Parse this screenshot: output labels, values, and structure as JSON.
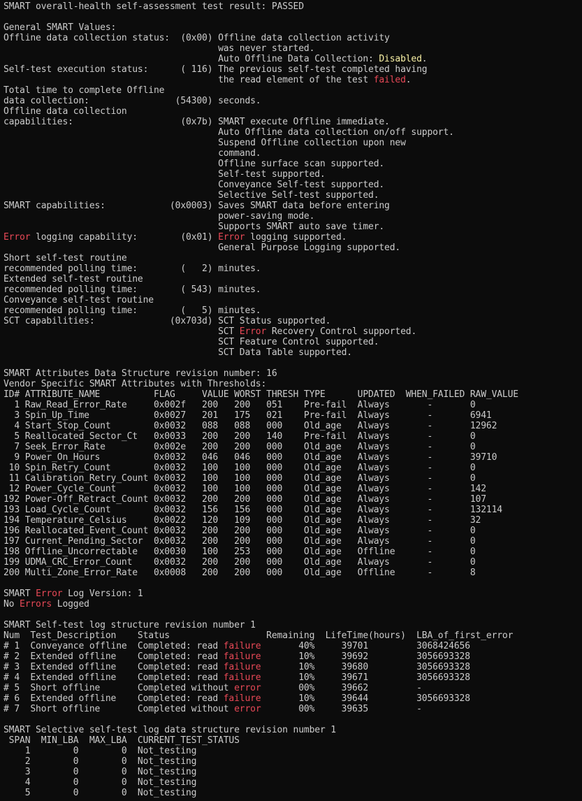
{
  "colors": {
    "background": "#0c0c0c",
    "text": "#cccccc",
    "red": "#e74856",
    "yellow": "#f9f1a5"
  },
  "lines": [
    [
      [
        "SMART overall-health self-assessment test result: PASSED",
        ""
      ]
    ],
    [
      [
        "",
        ""
      ]
    ],
    [
      [
        "General SMART Values:",
        ""
      ]
    ],
    [
      [
        "Offline data collection status:  (0x00) Offline data collection activity",
        ""
      ]
    ],
    [
      [
        "                                        was never started.",
        ""
      ]
    ],
    [
      [
        "                                        Auto Offline Data Collection: ",
        ""
      ],
      [
        "Disabled",
        "yellow"
      ],
      [
        ".",
        ""
      ]
    ],
    [
      [
        "Self-test execution status:      ( 116) The previous self-test completed having",
        ""
      ]
    ],
    [
      [
        "                                        the read element of the test ",
        ""
      ],
      [
        "failed",
        "red"
      ],
      [
        ".",
        ""
      ]
    ],
    [
      [
        "Total time to complete Offline",
        ""
      ]
    ],
    [
      [
        "data collection:                (54300) seconds.",
        ""
      ]
    ],
    [
      [
        "Offline data collection",
        ""
      ]
    ],
    [
      [
        "capabilities:                    (0x7b) SMART execute Offline immediate.",
        ""
      ]
    ],
    [
      [
        "                                        Auto Offline data collection on/off support.",
        ""
      ]
    ],
    [
      [
        "                                        Suspend Offline collection upon new",
        ""
      ]
    ],
    [
      [
        "                                        command.",
        ""
      ]
    ],
    [
      [
        "                                        Offline surface scan supported.",
        ""
      ]
    ],
    [
      [
        "                                        Self-test supported.",
        ""
      ]
    ],
    [
      [
        "                                        Conveyance Self-test supported.",
        ""
      ]
    ],
    [
      [
        "                                        Selective Self-test supported.",
        ""
      ]
    ],
    [
      [
        "SMART capabilities:            (0x0003) Saves SMART data before entering",
        ""
      ]
    ],
    [
      [
        "                                        power-saving mode.",
        ""
      ]
    ],
    [
      [
        "                                        Supports SMART auto save timer.",
        ""
      ]
    ],
    [
      [
        "Error",
        "red"
      ],
      [
        " logging capability:        (0x01) ",
        ""
      ],
      [
        "Error",
        "red"
      ],
      [
        " logging supported.",
        ""
      ]
    ],
    [
      [
        "                                        General Purpose Logging supported.",
        ""
      ]
    ],
    [
      [
        "Short self-test routine",
        ""
      ]
    ],
    [
      [
        "recommended polling time:        (   2) minutes.",
        ""
      ]
    ],
    [
      [
        "Extended self-test routine",
        ""
      ]
    ],
    [
      [
        "recommended polling time:        ( 543) minutes.",
        ""
      ]
    ],
    [
      [
        "Conveyance self-test routine",
        ""
      ]
    ],
    [
      [
        "recommended polling time:        (   5) minutes.",
        ""
      ]
    ],
    [
      [
        "SCT capabilities:              (0x703d) SCT Status supported.",
        ""
      ]
    ],
    [
      [
        "                                        SCT ",
        ""
      ],
      [
        "Error",
        "red"
      ],
      [
        " Recovery Control supported.",
        ""
      ]
    ],
    [
      [
        "                                        SCT Feature Control supported.",
        ""
      ]
    ],
    [
      [
        "                                        SCT Data Table supported.",
        ""
      ]
    ],
    [
      [
        "",
        ""
      ]
    ],
    [
      [
        "SMART Attributes Data Structure revision number: 16",
        ""
      ]
    ],
    [
      [
        "Vendor Specific SMART Attributes with Thresholds:",
        ""
      ]
    ],
    [
      [
        "ID# ATTRIBUTE_NAME          FLAG     VALUE WORST THRESH TYPE      UPDATED  WHEN_FAILED RAW_VALUE",
        ""
      ]
    ],
    [
      [
        "  1 Raw_Read_Error_Rate     0x002f   200   200   051    Pre-fail  Always       -       0",
        ""
      ]
    ],
    [
      [
        "  3 Spin_Up_Time            0x0027   201   175   021    Pre-fail  Always       -       6941",
        ""
      ]
    ],
    [
      [
        "  4 Start_Stop_Count        0x0032   088   088   000    Old_age   Always       -       12962",
        ""
      ]
    ],
    [
      [
        "  5 Reallocated_Sector_Ct   0x0033   200   200   140    Pre-fail  Always       -       0",
        ""
      ]
    ],
    [
      [
        "  7 Seek_Error_Rate         0x002e   200   200   000    Old_age   Always       -       0",
        ""
      ]
    ],
    [
      [
        "  9 Power_On_Hours          0x0032   046   046   000    Old_age   Always       -       39710",
        ""
      ]
    ],
    [
      [
        " 10 Spin_Retry_Count        0x0032   100   100   000    Old_age   Always       -       0",
        ""
      ]
    ],
    [
      [
        " 11 Calibration_Retry_Count 0x0032   100   100   000    Old_age   Always       -       0",
        ""
      ]
    ],
    [
      [
        " 12 Power_Cycle_Count       0x0032   100   100   000    Old_age   Always       -       142",
        ""
      ]
    ],
    [
      [
        "192 Power-Off_Retract_Count 0x0032   200   200   000    Old_age   Always       -       107",
        ""
      ]
    ],
    [
      [
        "193 Load_Cycle_Count        0x0032   156   156   000    Old_age   Always       -       132114",
        ""
      ]
    ],
    [
      [
        "194 Temperature_Celsius     0x0022   120   109   000    Old_age   Always       -       32",
        ""
      ]
    ],
    [
      [
        "196 Reallocated_Event_Count 0x0032   200   200   000    Old_age   Always       -       0",
        ""
      ]
    ],
    [
      [
        "197 Current_Pending_Sector  0x0032   200   200   000    Old_age   Always       -       0",
        ""
      ]
    ],
    [
      [
        "198 Offline_Uncorrectable   0x0030   100   253   000    Old_age   Offline      -       0",
        ""
      ]
    ],
    [
      [
        "199 UDMA_CRC_Error_Count    0x0032   200   200   000    Old_age   Always       -       0",
        ""
      ]
    ],
    [
      [
        "200 Multi_Zone_Error_Rate   0x0008   200   200   000    Old_age   Offline      -       8",
        ""
      ]
    ],
    [
      [
        "",
        ""
      ]
    ],
    [
      [
        "SMART ",
        ""
      ],
      [
        "Error",
        "red"
      ],
      [
        " Log Version: 1",
        ""
      ]
    ],
    [
      [
        "No ",
        ""
      ],
      [
        "Errors",
        "red"
      ],
      [
        " Logged",
        ""
      ]
    ],
    [
      [
        "",
        ""
      ]
    ],
    [
      [
        "SMART Self-test log structure revision number 1",
        ""
      ]
    ],
    [
      [
        "Num  Test_Description    Status                  Remaining  LifeTime(hours)  LBA_of_first_error",
        ""
      ]
    ],
    [
      [
        "# 1  Conveyance offline  Completed: read ",
        ""
      ],
      [
        "failure",
        "red"
      ],
      [
        "       40%     39701         3068424656",
        ""
      ]
    ],
    [
      [
        "# 2  Extended offline    Completed: read ",
        ""
      ],
      [
        "failure",
        "red"
      ],
      [
        "       10%     39692         3056693328",
        ""
      ]
    ],
    [
      [
        "# 3  Extended offline    Completed: read ",
        ""
      ],
      [
        "failure",
        "red"
      ],
      [
        "       10%     39680         3056693328",
        ""
      ]
    ],
    [
      [
        "# 4  Extended offline    Completed: read ",
        ""
      ],
      [
        "failure",
        "red"
      ],
      [
        "       10%     39671         3056693328",
        ""
      ]
    ],
    [
      [
        "# 5  Short offline       Completed without ",
        ""
      ],
      [
        "error",
        "red"
      ],
      [
        "       00%     39662         -",
        ""
      ]
    ],
    [
      [
        "# 6  Extended offline    Completed: read ",
        ""
      ],
      [
        "failure",
        "red"
      ],
      [
        "       10%     39644         3056693328",
        ""
      ]
    ],
    [
      [
        "# 7  Short offline       Completed without ",
        ""
      ],
      [
        "error",
        "red"
      ],
      [
        "       00%     39635         -",
        ""
      ]
    ],
    [
      [
        "",
        ""
      ]
    ],
    [
      [
        "SMART Selective self-test log data structure revision number 1",
        ""
      ]
    ],
    [
      [
        " SPAN  MIN_LBA  MAX_LBA  CURRENT_TEST_STATUS",
        ""
      ]
    ],
    [
      [
        "    1        0        0  Not_testing",
        ""
      ]
    ],
    [
      [
        "    2        0        0  Not_testing",
        ""
      ]
    ],
    [
      [
        "    3        0        0  Not_testing",
        ""
      ]
    ],
    [
      [
        "    4        0        0  Not_testing",
        ""
      ]
    ],
    [
      [
        "    5        0        0  Not_testing",
        ""
      ]
    ]
  ]
}
